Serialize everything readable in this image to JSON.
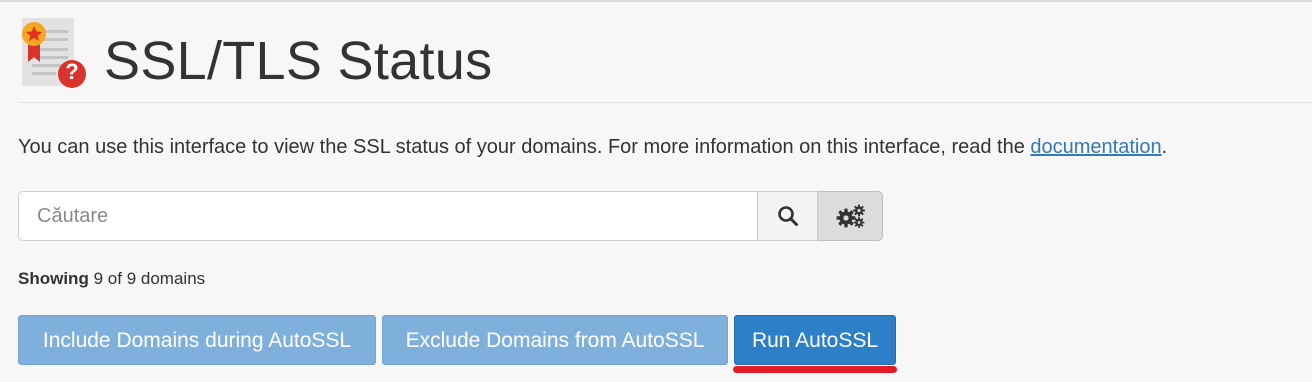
{
  "header": {
    "title": "SSL/TLS Status",
    "icon": "certificate-question-icon",
    "badge_symbol": "?"
  },
  "description": {
    "text": "You can use this interface to view the SSL status of your domains. For more information on this interface, read the ",
    "link_label": "documentation",
    "suffix": "."
  },
  "search": {
    "placeholder": "Căutare",
    "value": "",
    "search_icon": "search-icon",
    "settings_icon": "gears-icon"
  },
  "summary": {
    "label": "Showing",
    "shown": "9",
    "of_word": "of",
    "total": "9",
    "unit": "domains"
  },
  "actions": {
    "include_label": "Include Domains during AutoSSL",
    "exclude_label": "Exclude Domains from AutoSSL",
    "run_label": "Run AutoSSL"
  },
  "colors": {
    "primary": "#2d7fc7",
    "primary_light": "#7fb0dc",
    "link": "#337ab7",
    "badge": "#d9342b",
    "medal": "#f5a623",
    "highlight_mark": "#e21b24"
  }
}
